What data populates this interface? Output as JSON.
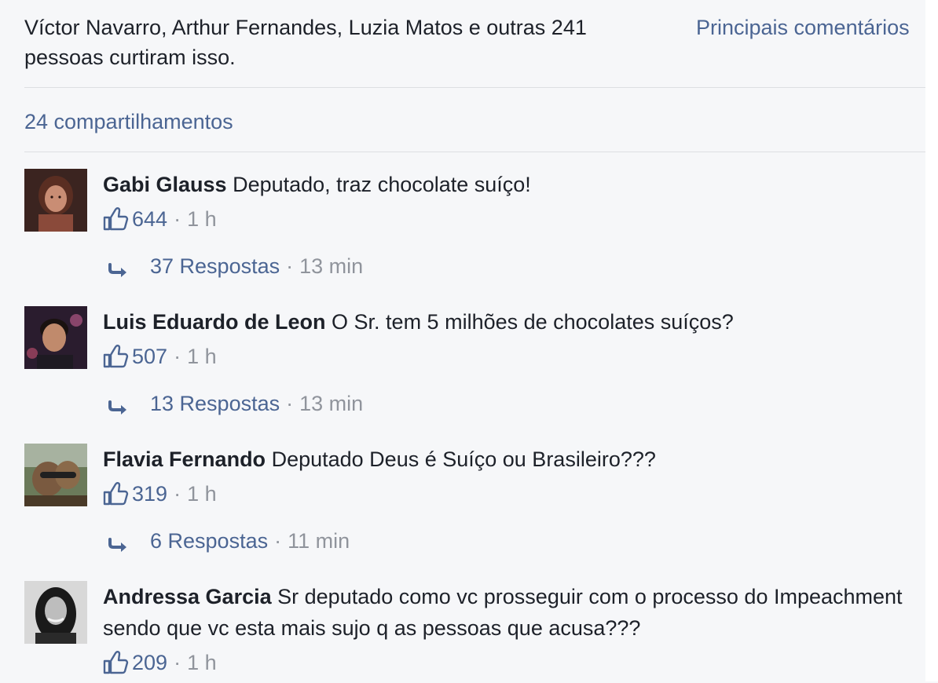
{
  "summary": {
    "likes_text": "Víctor Navarro, Arthur Fernandes, Luzia Matos e outras 241 pessoas curtiram isso.",
    "sort_label": "Principais comentários",
    "shares": "24 compartilhamentos"
  },
  "colors": {
    "link": "#4b6593",
    "muted": "#90949c",
    "text": "#1d2129",
    "background": "#f6f7f9"
  },
  "comments": [
    {
      "author": "Gabi Glauss",
      "text": "Deputado, traz chocolate suíço!",
      "likes": "644",
      "time": "1 h",
      "replies": "37 Respostas",
      "replies_time": "13 min"
    },
    {
      "author": "Luis Eduardo de Leon",
      "text": "O Sr. tem 5 milhões de chocolates suíços?",
      "likes": "507",
      "time": "1 h",
      "replies": "13 Respostas",
      "replies_time": "13 min"
    },
    {
      "author": "Flavia Fernando",
      "text": "Deputado Deus é Suíço ou Brasileiro???",
      "likes": "319",
      "time": "1 h",
      "replies": "6 Respostas",
      "replies_time": "11 min"
    },
    {
      "author": "Andressa Garcia",
      "text": "Sr deputado como vc prosseguir com o processo do Impeachment sendo que vc esta mais sujo q as pessoas que acusa???",
      "likes": "209",
      "time": "1 h"
    }
  ],
  "separator": "·"
}
